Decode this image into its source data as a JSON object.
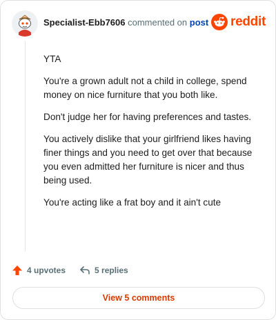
{
  "header": {
    "username": "Specialist-Ebb7606",
    "commented_on": "commented on",
    "post_link": "post",
    "logo_text": "reddit"
  },
  "comment": {
    "paragraphs": [
      "YTA",
      "You're a grown adult not a child in college, spend money on nice furniture that you both like.",
      "Don't judge her for having preferences and tastes.",
      "You actively dislike that your girlfriend likes having finer things and you need to get over that because you even admitted her furniture is nicer and thus being used.",
      "You're acting like a frat boy and it ain't cute"
    ]
  },
  "actions": {
    "upvotes": "4 upvotes",
    "replies": "5 replies"
  },
  "footer": {
    "view_comments": "View 5 comments"
  },
  "colors": {
    "accent": "#ff4500",
    "link": "#0045ac",
    "muted": "#576f76"
  }
}
